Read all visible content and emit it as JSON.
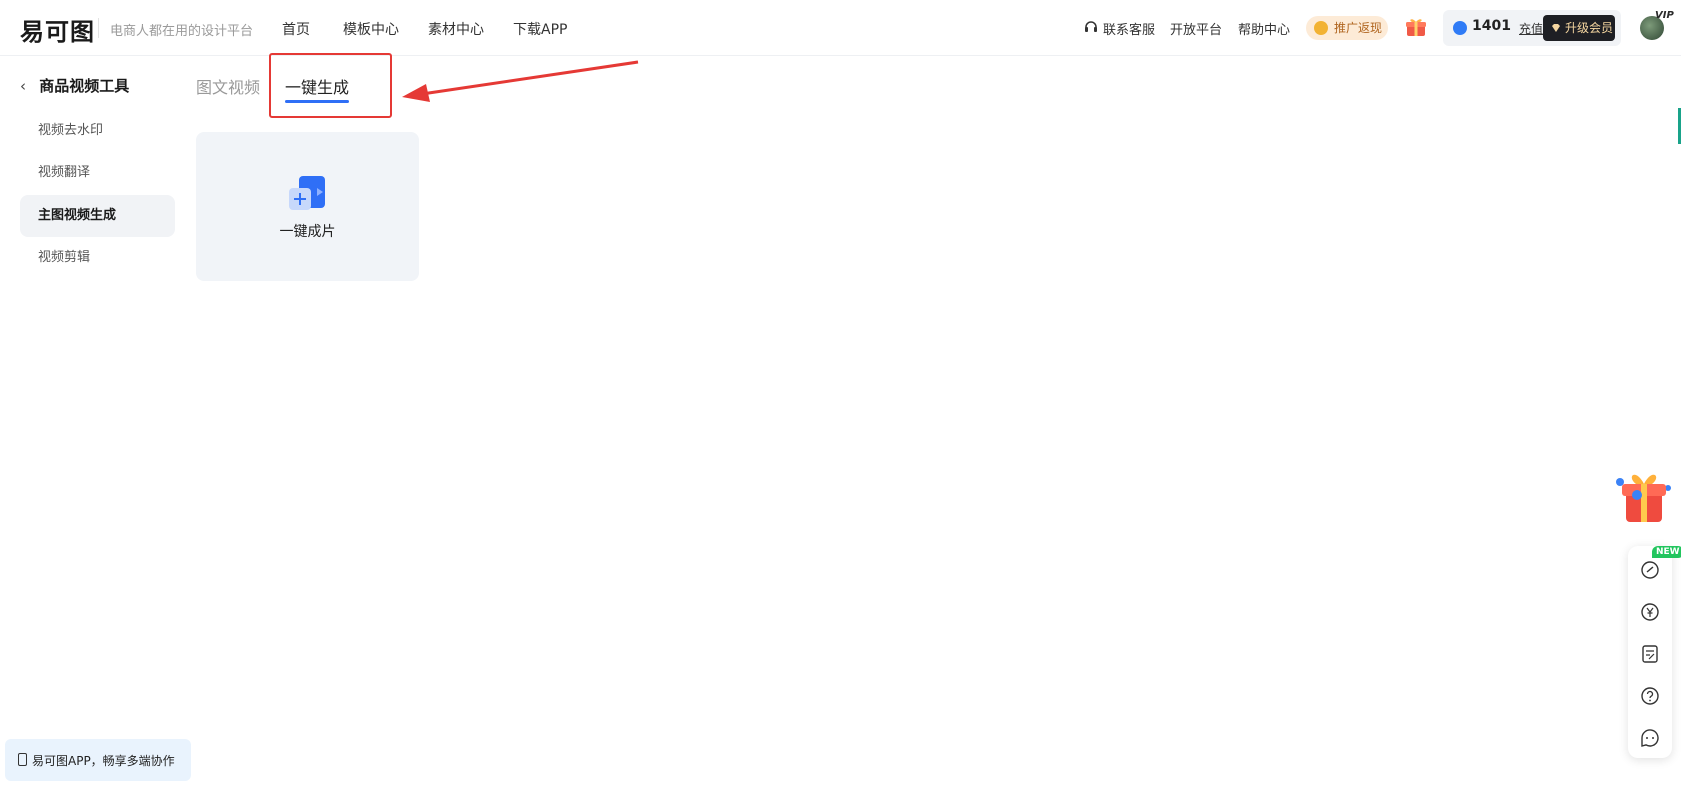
{
  "header": {
    "logo": "易可图",
    "slogan": "电商人都在用的设计平台",
    "nav": [
      "首页",
      "模板中心",
      "素材中心",
      "下载APP"
    ],
    "support": "联系客服",
    "open_platform": "开放平台",
    "help": "帮助中心",
    "promo": "推广返现",
    "points": "1401",
    "recharge": "充值",
    "upgrade": "升级会员",
    "vip_tag": "VIP"
  },
  "sidebar": {
    "title": "商品视频工具",
    "items": [
      {
        "label": "视频去水印",
        "active": false
      },
      {
        "label": "视频翻译",
        "active": false
      },
      {
        "label": "主图视频生成",
        "active": true
      },
      {
        "label": "视频剪辑",
        "active": false
      }
    ]
  },
  "tabs": [
    {
      "label": "图文视频",
      "active": false
    },
    {
      "label": "一键生成",
      "active": true
    }
  ],
  "card": {
    "label": "一键成片"
  },
  "app_promo": "易可图APP，畅享多端协作",
  "float": {
    "new_badge": "NEW"
  },
  "colors": {
    "accent": "#2f6ff6",
    "annotation": "#e53935",
    "vip_button": "#1e1f24",
    "active_bg": "#f1f3f6"
  }
}
